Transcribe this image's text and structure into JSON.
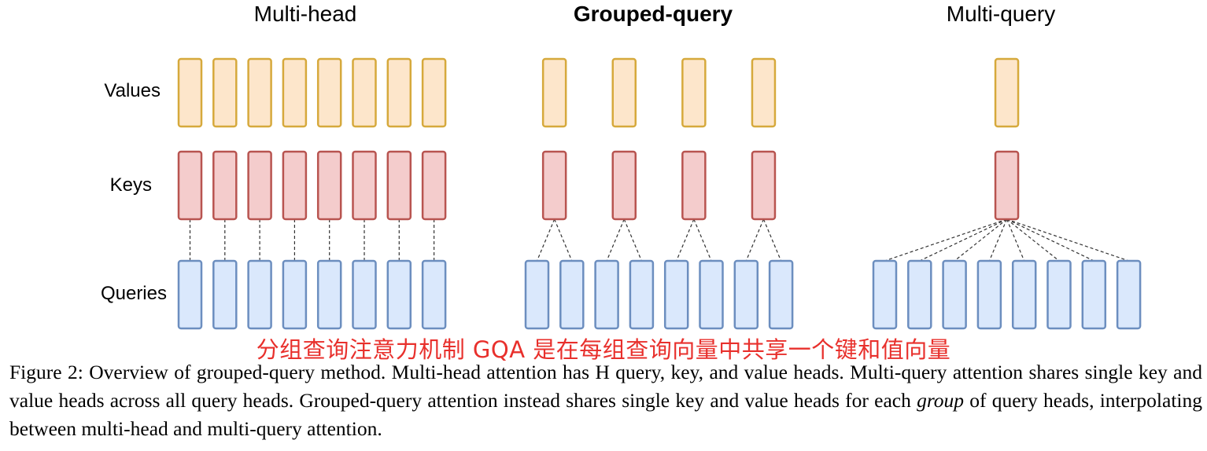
{
  "panels": [
    {
      "id": "multi-head",
      "title": "Multi-head",
      "bold": false,
      "n_queries": 8,
      "n_kv": 8
    },
    {
      "id": "grouped-query",
      "title": "Grouped-query",
      "bold": true,
      "n_queries": 8,
      "n_kv": 4
    },
    {
      "id": "multi-query",
      "title": "Multi-query",
      "bold": false,
      "n_queries": 8,
      "n_kv": 1
    }
  ],
  "row_labels": {
    "values": "Values",
    "keys": "Keys",
    "queries": "Queries"
  },
  "colors": {
    "values_fill": "#fde6cb",
    "values_stroke": "#d6a93c",
    "keys_fill": "#f4cccc",
    "keys_stroke": "#b85450",
    "queries_fill": "#dae8fc",
    "queries_stroke": "#6c8ebf",
    "connector": "#333333",
    "annotation": "#e8302c"
  },
  "annotation": "分组查询注意力机制 GQA 是在每组查询向量中共享一个键和值向量",
  "caption": {
    "part1": "Figure 2: Overview of grouped-query method. Multi-head attention has H query, key, and value heads. Multi-query attention shares single key and value heads across all query heads. Grouped-query attention instead shares single key and value heads for each ",
    "italic": "group",
    "part2": " of query heads, interpolating between multi-head and multi-query attention."
  }
}
